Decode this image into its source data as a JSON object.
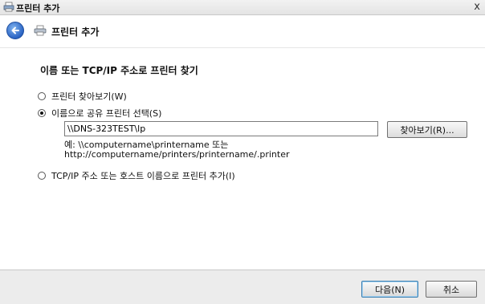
{
  "window": {
    "title": "프린터 추가",
    "close_glyph": "x"
  },
  "nav": {
    "title": "프린터 추가"
  },
  "main": {
    "heading": "이름 또는 TCP/IP 주소로 프린터 찾기",
    "options": [
      {
        "label": "프린터 찾아보기(W)",
        "selected": false
      },
      {
        "label": "이름으로 공유 프린터 선택(S)",
        "selected": true
      },
      {
        "label": "TCP/IP 주소 또는 호스트 이름으로 프린터 추가(I)",
        "selected": false
      }
    ],
    "share_path_value": "\\\\DNS-323TEST\\lp",
    "browse_label": "찾아보기(R)...",
    "example_line1": "예: \\\\computername\\printername 또는",
    "example_line2": "http://computername/printers/printername/.printer"
  },
  "footer": {
    "next_label": "다음(N)",
    "cancel_label": "취소"
  },
  "icons": {
    "app": "printer-icon",
    "back": "back-arrow-icon",
    "nav": "printer-icon"
  }
}
